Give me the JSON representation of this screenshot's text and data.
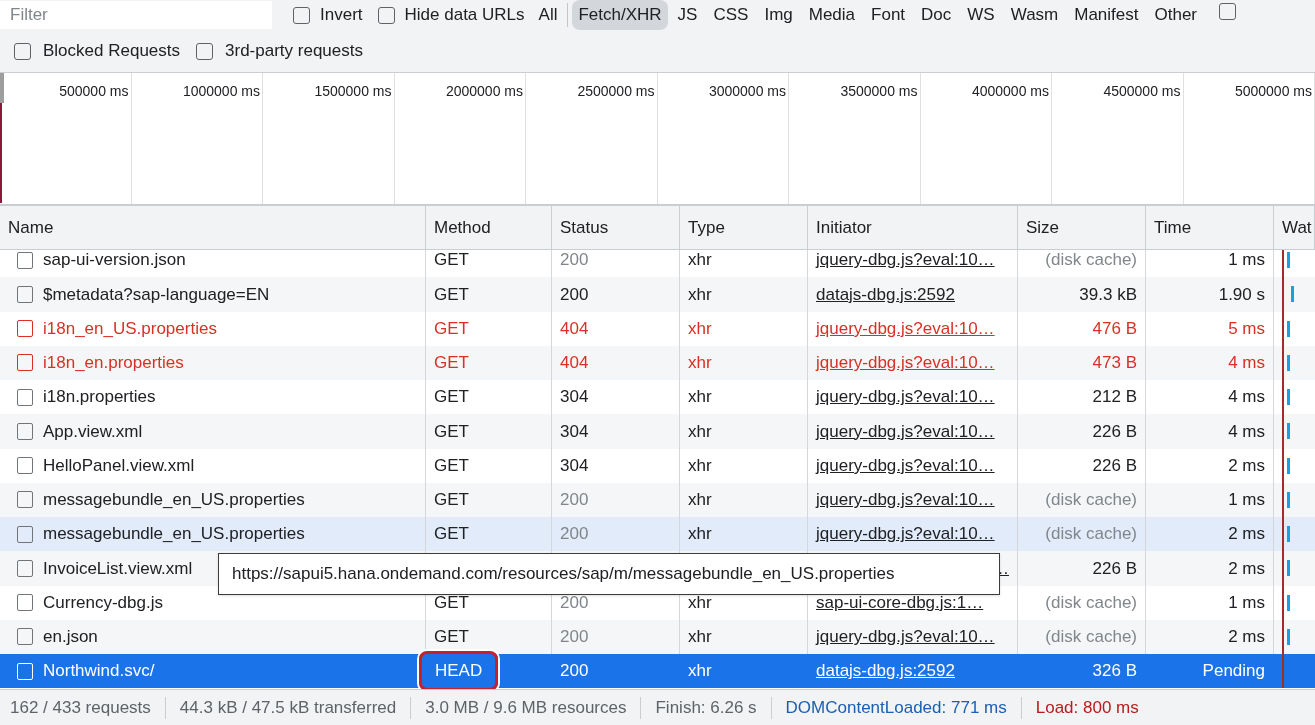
{
  "filter_bar": {
    "filter": {
      "placeholder": "Filter"
    },
    "options": [
      {
        "label": "Invert",
        "checked": false
      },
      {
        "label": "Hide data URLs",
        "checked": false
      }
    ],
    "types": [
      {
        "label": "All",
        "selected": false
      },
      {
        "label": "Fetch/XHR",
        "selected": true
      },
      {
        "label": "JS",
        "selected": false
      },
      {
        "label": "CSS",
        "selected": false
      },
      {
        "label": "Img",
        "selected": false
      },
      {
        "label": "Media",
        "selected": false
      },
      {
        "label": "Font",
        "selected": false
      },
      {
        "label": "Doc",
        "selected": false
      },
      {
        "label": "WS",
        "selected": false
      },
      {
        "label": "Wasm",
        "selected": false
      },
      {
        "label": "Manifest",
        "selected": false
      },
      {
        "label": "Other",
        "selected": false
      }
    ],
    "trailing_checkbox": {
      "checked": false
    },
    "options_row2": [
      {
        "label": "Blocked Requests",
        "checked": false
      },
      {
        "label": "3rd-party requests",
        "checked": false
      }
    ]
  },
  "overview": {
    "ticks": [
      "500000 ms",
      "1000000 ms",
      "1500000 ms",
      "2000000 ms",
      "2500000 ms",
      "3000000 ms",
      "3500000 ms",
      "4000000 ms",
      "4500000 ms",
      "5000000 ms"
    ]
  },
  "table": {
    "columns": [
      "Name",
      "Method",
      "Status",
      "Type",
      "Initiator",
      "Size",
      "Time",
      "Wat"
    ],
    "rows": [
      {
        "kind": "normal",
        "cached": true,
        "hovered": false,
        "name": "sap-ui-version.json",
        "method": "GET",
        "status": "200",
        "type": "xhr",
        "initiator": "jquery-dbg.js?eval:10…",
        "size": "(disk cache)",
        "time": "1 ms"
      },
      {
        "kind": "normal",
        "cached": false,
        "hovered": false,
        "name": "$metadata?sap-language=EN",
        "method": "GET",
        "status": "200",
        "type": "xhr",
        "initiator": "datajs-dbg.js:2592",
        "size": "39.3 kB",
        "time": "1.90 s"
      },
      {
        "kind": "error",
        "hovered": false,
        "name": "i18n_en_US.properties",
        "method": "GET",
        "status": "404",
        "type": "xhr",
        "initiator": "jquery-dbg.js?eval:10…",
        "size": "476 B",
        "time": "5 ms"
      },
      {
        "kind": "error",
        "hovered": false,
        "name": "i18n_en.properties",
        "method": "GET",
        "status": "404",
        "type": "xhr",
        "initiator": "jquery-dbg.js?eval:10…",
        "size": "473 B",
        "time": "4 ms"
      },
      {
        "kind": "normal",
        "cached": false,
        "hovered": false,
        "name": "i18n.properties",
        "method": "GET",
        "status": "304",
        "type": "xhr",
        "initiator": "jquery-dbg.js?eval:10…",
        "size": "212 B",
        "time": "4 ms"
      },
      {
        "kind": "normal",
        "cached": false,
        "hovered": false,
        "name": "App.view.xml",
        "method": "GET",
        "status": "304",
        "type": "xhr",
        "initiator": "jquery-dbg.js?eval:10…",
        "size": "226 B",
        "time": "4 ms"
      },
      {
        "kind": "normal",
        "cached": false,
        "hovered": false,
        "name": "HelloPanel.view.xml",
        "method": "GET",
        "status": "304",
        "type": "xhr",
        "initiator": "jquery-dbg.js?eval:10…",
        "size": "226 B",
        "time": "2 ms"
      },
      {
        "kind": "normal",
        "cached": true,
        "hovered": false,
        "name": "messagebundle_en_US.properties",
        "method": "GET",
        "status": "200",
        "type": "xhr",
        "initiator": "jquery-dbg.js?eval:10…",
        "size": "(disk cache)",
        "time": "1 ms"
      },
      {
        "kind": "normal",
        "cached": true,
        "hovered": true,
        "name": "messagebundle_en_US.properties",
        "method": "GET",
        "status": "200",
        "type": "xhr",
        "initiator": "jquery-dbg.js?eval:10…",
        "size": "(disk cache)",
        "time": "2 ms"
      },
      {
        "kind": "covered",
        "cached": false,
        "hovered": false,
        "name": "InvoiceList.view.xml",
        "initiator": "…",
        "size": "226 B",
        "time": "2 ms"
      },
      {
        "kind": "normal",
        "cached": true,
        "hovered": false,
        "name": "Currency-dbg.js",
        "method": "GET",
        "status": "200",
        "type": "xhr",
        "initiator": "sap-ui-core-dbg.js:1…",
        "size": "(disk cache)",
        "time": "1 ms"
      },
      {
        "kind": "normal",
        "cached": true,
        "hovered": false,
        "name": "en.json",
        "method": "GET",
        "status": "200",
        "type": "xhr",
        "initiator": "jquery-dbg.js?eval:10…",
        "size": "(disk cache)",
        "time": "2 ms"
      },
      {
        "kind": "selected",
        "method_circled": true,
        "name": "Northwind.svc/",
        "method": "HEAD",
        "status": "200",
        "type": "xhr",
        "initiator": "datajs-dbg.js:2592",
        "size": "326 B",
        "time": "Pending"
      }
    ]
  },
  "tooltip": "https://sapui5.hana.ondemand.com/resources/sap/m/messagebundle_en_US.properties",
  "status_bar": [
    {
      "kind": "plain",
      "text": "162 / 433 requests"
    },
    {
      "kind": "plain",
      "text": "44.3 kB / 47.5 kB transferred"
    },
    {
      "kind": "plain",
      "text": "3.0 MB / 9.6 MB resources"
    },
    {
      "kind": "plain",
      "text": "Finish: 6.26 s"
    },
    {
      "kind": "dom",
      "text": "DOMContentLoaded: 771 ms"
    },
    {
      "kind": "load",
      "text": "Load: 800 ms"
    }
  ]
}
